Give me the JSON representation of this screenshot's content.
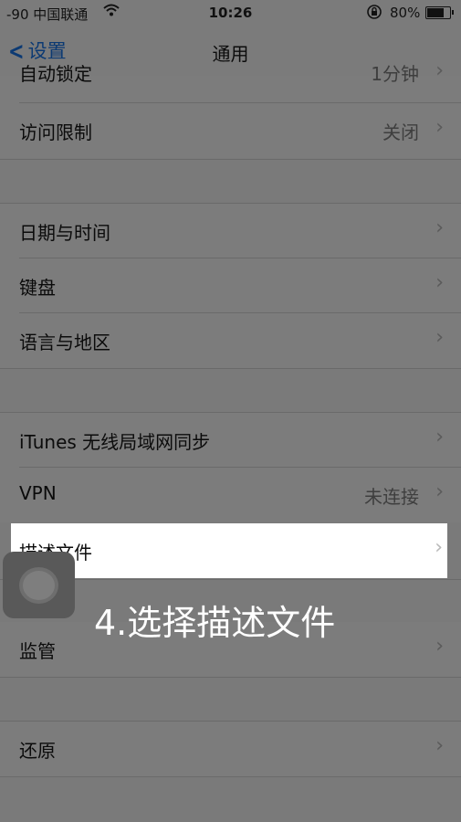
{
  "status_bar": {
    "carrier": "-90 中国联通",
    "time": "10:26",
    "battery_percent": "80%",
    "battery_level": 0.8,
    "icons": [
      "wifi-icon",
      "rotation-lock-icon",
      "battery-icon"
    ]
  },
  "nav": {
    "back_label": "设置",
    "title": "通用"
  },
  "cells": {
    "auto_lock": {
      "label": "自动锁定",
      "detail": "1分钟"
    },
    "restrictions": {
      "label": "访问限制",
      "detail": "关闭"
    },
    "date_time": {
      "label": "日期与时间"
    },
    "keyboard": {
      "label": "键盘"
    },
    "language_region": {
      "label": "语言与地区"
    },
    "itunes_sync": {
      "label": "iTunes 无线局域网同步"
    },
    "vpn": {
      "label": "VPN",
      "detail": "未连接"
    },
    "profile": {
      "label": "描述文件"
    },
    "supervision": {
      "label": "监管"
    },
    "reset": {
      "label": "还原"
    }
  },
  "chevron_glyph": "›",
  "caption": "4.选择描述文件",
  "colors": {
    "dimmed_background": "#7a7a7a",
    "highlight_background": "#ffffff",
    "back_tint": "#0c3a73"
  }
}
